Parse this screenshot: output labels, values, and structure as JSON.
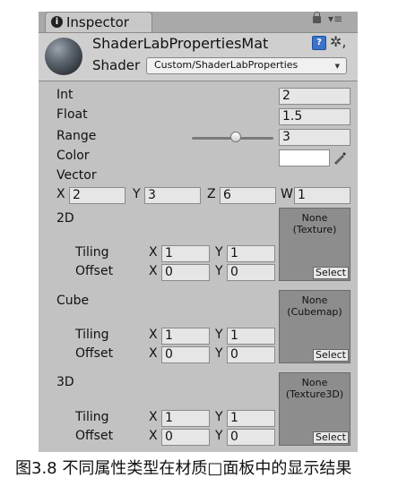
{
  "tab": {
    "icon": "info-icon",
    "icon_glyph": "i",
    "label": "Inspector"
  },
  "header": {
    "material_name": "ShaderLabPropertiesMat",
    "shader_label": "Shader",
    "shader_value": "Custom/ShaderLabProperties",
    "menu_glyph": "▾≡",
    "help_glyph": "?",
    "gear_glyph": "✲,"
  },
  "properties": {
    "int": {
      "label": "Int",
      "value": "2"
    },
    "float": {
      "label": "Float",
      "value": "1.5"
    },
    "range": {
      "label": "Range",
      "value": "3"
    },
    "color": {
      "label": "Color"
    },
    "vector": {
      "label": "Vector",
      "x_label": "X",
      "x": "2",
      "y_label": "Y",
      "y": "3",
      "z_label": "Z",
      "z": "6",
      "w_label": "W",
      "w": "1"
    }
  },
  "textures": [
    {
      "label": "2D",
      "slot_line1": "None",
      "slot_line2": "(Texture)",
      "select_label": "Select",
      "tiling_label": "Tiling",
      "tiling_x": "1",
      "tiling_y": "1",
      "offset_label": "Offset",
      "offset_x": "0",
      "offset_y": "0"
    },
    {
      "label": "Cube",
      "slot_line1": "None",
      "slot_line2": "(Cubemap)",
      "select_label": "Select",
      "tiling_label": "Tiling",
      "tiling_x": "1",
      "tiling_y": "1",
      "offset_label": "Offset",
      "offset_x": "0",
      "offset_y": "0"
    },
    {
      "label": "3D",
      "slot_line1": "None",
      "slot_line2": "(Texture3D)",
      "select_label": "Select",
      "tiling_label": "Tiling",
      "tiling_x": "1",
      "tiling_y": "1",
      "offset_label": "Offset",
      "offset_x": "0",
      "offset_y": "0"
    }
  ],
  "axis_labels": {
    "x": "X",
    "y": "Y"
  },
  "caption": "图3.8 不同属性类型在材质□面板中的显示结果",
  "colors": {
    "panel": "#c2c2c2",
    "field": "#e6e6e6",
    "slot": "#8d8d8d"
  }
}
